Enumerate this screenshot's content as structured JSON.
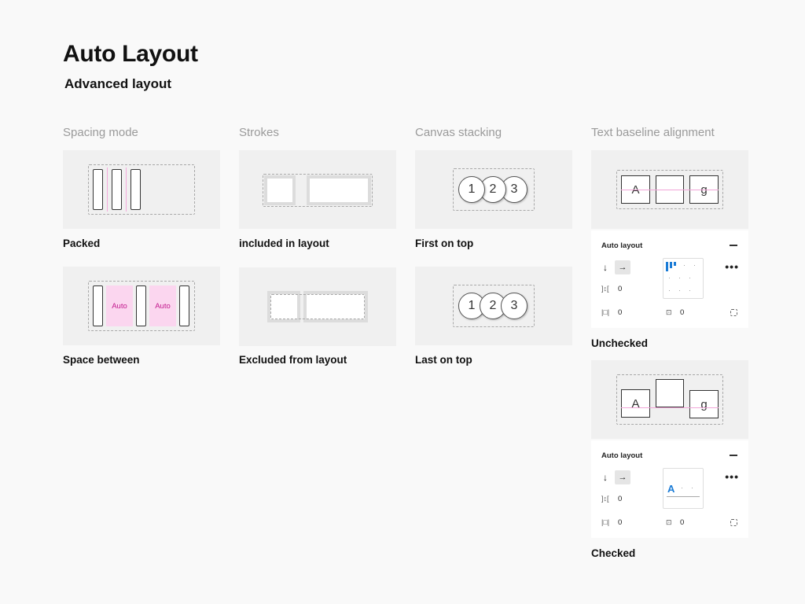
{
  "header": {
    "title": "Auto Layout",
    "subtitle": "Advanced layout"
  },
  "columns": {
    "spacing": {
      "heading": "Spacing mode",
      "cards": [
        {
          "caption": "Packed"
        },
        {
          "caption": "Space between",
          "auto_label": "Auto"
        }
      ]
    },
    "strokes": {
      "heading": "Strokes",
      "cards": [
        {
          "caption": "included in layout"
        },
        {
          "caption": "Excluded from layout"
        }
      ]
    },
    "stacking": {
      "heading": "Canvas stacking",
      "circles": [
        "1",
        "2",
        "3"
      ],
      "cards": [
        {
          "caption": "First on top"
        },
        {
          "caption": "Last on top"
        }
      ]
    },
    "baseline": {
      "heading": "Text baseline alignment",
      "glyph_a": "A",
      "glyph_g": "g",
      "cards": [
        {
          "caption": "Unchecked"
        },
        {
          "caption": "Checked"
        }
      ],
      "panel": {
        "title": "Auto layout",
        "gap_value": "0",
        "padding_h_value": "0",
        "padding_v_value": "0",
        "direction_down": "↓",
        "direction_right": "→",
        "more": "•••",
        "checked_letter": "A"
      }
    }
  },
  "colors": {
    "background": "#f9f9f9",
    "card": "#f0f0f0",
    "pink_fill": "#fbd6ef",
    "pink_text": "#c2188d",
    "accent_blue": "#1a7bd6"
  }
}
